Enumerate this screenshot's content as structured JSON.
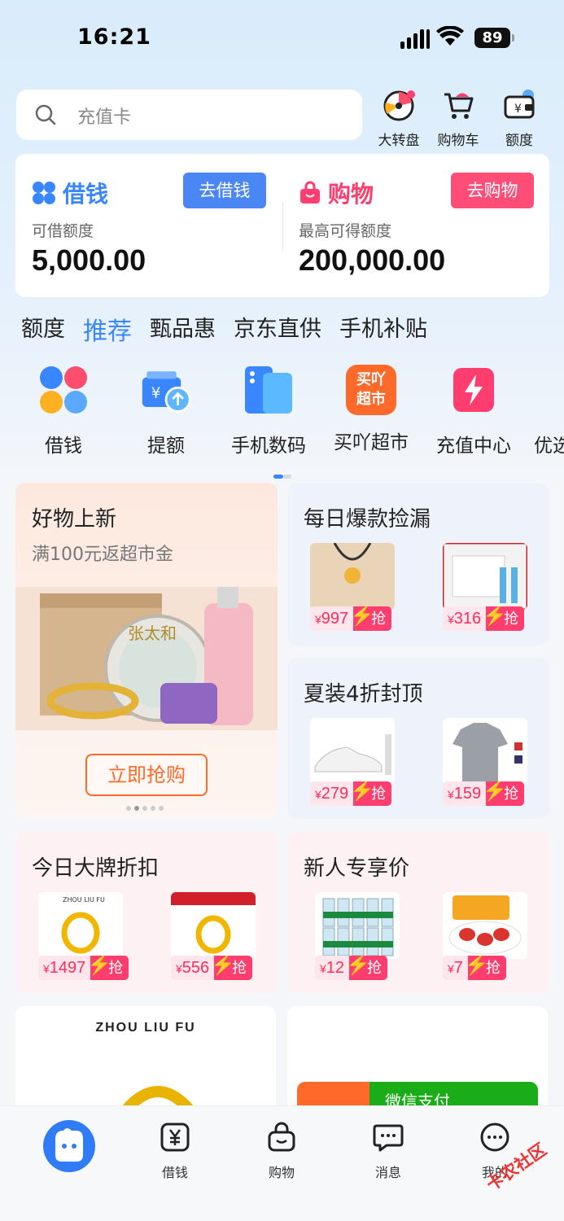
{
  "status_bar": {
    "time": "16:21",
    "battery": "89"
  },
  "search": {
    "placeholder": "充值卡"
  },
  "top_icons": [
    {
      "label": "大转盘",
      "icon": "wheel-icon"
    },
    {
      "label": "购物车",
      "icon": "cart-icon"
    },
    {
      "label": "额度",
      "icon": "wallet-icon"
    }
  ],
  "credit": {
    "borrow": {
      "title": "借钱",
      "button": "去借钱",
      "sub": "可借额度",
      "amount": "5,000.00"
    },
    "shop": {
      "title": "购物",
      "button": "去购物",
      "sub": "最高可得额度",
      "amount": "200,000.00"
    }
  },
  "tabs": [
    "额度",
    "推荐",
    "甄品惠",
    "京东直供",
    "手机补贴"
  ],
  "active_tab": "推荐",
  "quick_icons": [
    {
      "label": "借钱",
      "icon": "clover-icon"
    },
    {
      "label": "提额",
      "icon": "raise-limit-icon"
    },
    {
      "label": "手机数码",
      "icon": "phone-icon"
    },
    {
      "label": "买吖超市",
      "icon": "supermarket-icon",
      "badge_text": "买吖超市"
    },
    {
      "label": "充值中心",
      "icon": "lightning-icon"
    },
    {
      "label": "优选",
      "icon": "shield-icon"
    }
  ],
  "cards": {
    "new_goods": {
      "title": "好物上新",
      "subtitle": "满100元返超市金",
      "brand_text": "张太和",
      "button": "立即抢购"
    },
    "daily": {
      "title": "每日爆款捡漏",
      "items": [
        {
          "price": "997",
          "grab": "抢"
        },
        {
          "price": "316",
          "grab": "抢"
        }
      ]
    },
    "summer": {
      "title": "夏装4折封顶",
      "items": [
        {
          "price": "279",
          "grab": "抢"
        },
        {
          "price": "159",
          "grab": "抢"
        }
      ]
    },
    "brand": {
      "title": "今日大牌折扣",
      "items": [
        {
          "price": "1497",
          "grab": "抢",
          "brand": "ZHOU LIU FU"
        },
        {
          "price": "556",
          "grab": "抢"
        }
      ]
    },
    "newbie": {
      "title": "新人专享价",
      "items": [
        {
          "price": "12",
          "grab": "抢"
        },
        {
          "price": "7",
          "grab": "抢"
        }
      ]
    }
  },
  "bottom_cards": {
    "left_brand": "ZHOU LIU FU",
    "right_banner": "微信支付"
  },
  "currency": "¥",
  "bottom_nav": [
    {
      "label": "",
      "icon": "home-mascot-icon"
    },
    {
      "label": "借钱",
      "icon": "yen-icon"
    },
    {
      "label": "购物",
      "icon": "bag-icon"
    },
    {
      "label": "消息",
      "icon": "message-icon"
    },
    {
      "label": "我的",
      "icon": "profile-icon"
    }
  ],
  "watermark": "卡农社区",
  "colors": {
    "accent_blue": "#3a86ff",
    "accent_pink": "#ff3d6e",
    "orange": "#ff6a2b"
  }
}
